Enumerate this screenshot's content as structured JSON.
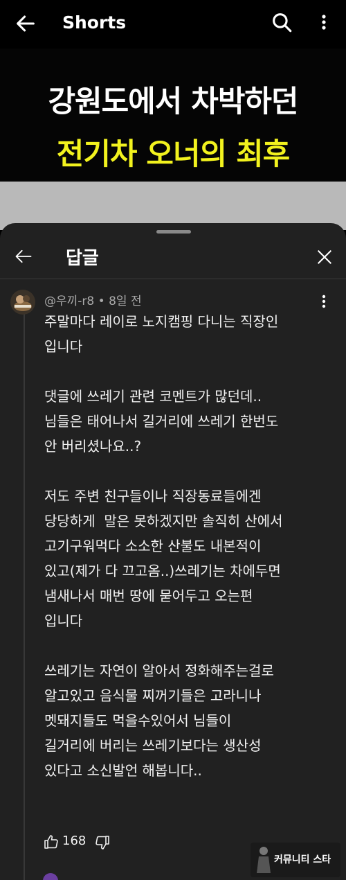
{
  "app_bar": {
    "title": "Shorts"
  },
  "video": {
    "headline_line1": "강원도에서 차박하던",
    "headline_line2": "전기차 오너의 최후"
  },
  "replies_sheet": {
    "title": "답글",
    "comment": {
      "author": "@우끼-r8",
      "time": "8일 전",
      "body": "주말마다 레이로 노지캠핑 다니는 직장인\n입니다\n\n댓글에 쓰레기 관련 코멘트가 많던데..\n님들은 태어나서 길거리에 쓰레기 한번도\n안 버리셨나요..?\n\n저도 주변 친구들이나 직장동료들에겐\n당당하게  말은 못하겠지만 솔직히 산에서\n고기구워먹다 소소한 산불도 내본적이\n있고(제가 다 끄고옴..)쓰레기는 차에두면\n냄새나서 매번 땅에 묻어두고 오는편\n입니다\n\n쓰레기는 자연이 알아서 정화해주는걸로\n알고있고 음식물 찌꺼기들은 고라니나\n멧돼지들도 먹을수있어서 님들이\n길거리에 버리는 쓰레기보다는 생산성\n있다고 소신발언 해봅니다..",
      "likes": "168"
    }
  },
  "watermark": {
    "text": "커뮤니티 스타"
  },
  "colors": {
    "headline_yellow": "#f2f21e",
    "sheet_bg": "#212121",
    "meta_grey": "#aaaaaa"
  }
}
